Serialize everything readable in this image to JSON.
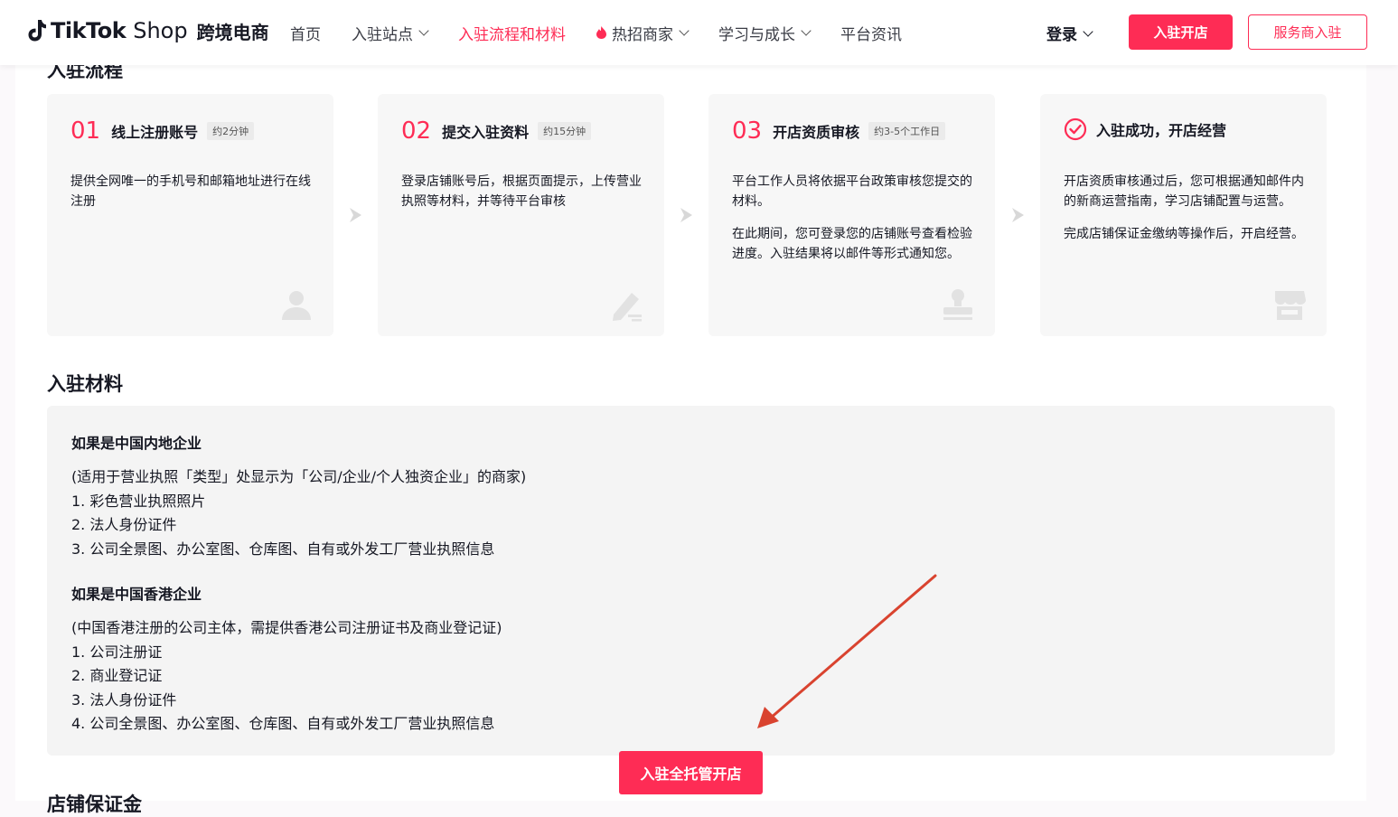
{
  "header": {
    "logo_brand": "TikTok",
    "logo_shop": "Shop",
    "logo_cn": "跨境电商",
    "nav": [
      {
        "label": "首页"
      },
      {
        "label": "入驻站点"
      },
      {
        "label": "入驻流程和材料"
      },
      {
        "label": "热招商家"
      },
      {
        "label": "学习与成长"
      },
      {
        "label": "平台资讯"
      }
    ],
    "login_label": "登录",
    "primary_btn": "入驻开店",
    "outline_btn": "服务商入驻"
  },
  "process": {
    "title": "入驻流程",
    "steps": [
      {
        "num": "01",
        "name": "线上注册账号",
        "tag": "约2分钟",
        "desc": [
          "提供全网唯一的手机号和邮箱地址进行在线注册"
        ],
        "icon": "user-icon"
      },
      {
        "num": "02",
        "name": "提交入驻资料",
        "tag": "约15分钟",
        "desc": [
          "登录店铺账号后，根据页面提示，上传营业执照等材料，并等待平台审核"
        ],
        "icon": "edit-icon"
      },
      {
        "num": "03",
        "name": "开店资质审核",
        "tag": "约3-5个工作日",
        "desc": [
          "平台工作人员将依据平台政策审核您提交的材料。",
          "在此期间，您可登录您的店铺账号查看检验进度。入驻结果将以邮件等形式通知您。"
        ],
        "icon": "stamp-icon"
      },
      {
        "num": "",
        "name": "入驻成功，开店经营",
        "tag": "",
        "desc": [
          "开店资质审核通过后，您可根据通知邮件内的新商运营指南，学习店铺配置与运营。",
          "完成店铺保证金缴纳等操作后，开启经营。"
        ],
        "icon": "store-icon"
      }
    ]
  },
  "materials": {
    "title": "入驻材料",
    "mainland": {
      "title": "如果是中国内地企业",
      "lines": [
        "(适用于营业执照「类型」处显示为「公司/企业/个人独资企业」的商家)",
        "1. 彩色营业执照照片",
        "2. 法人身份证件",
        "3. 公司全景图、办公室图、仓库图、自有或外发工厂营业执照信息"
      ]
    },
    "hongkong": {
      "title": "如果是中国香港企业",
      "lines": [
        "(中国香港注册的公司主体，需提供香港公司注册证书及商业登记证)",
        "1. 公司注册证",
        "2. 商业登记证",
        "3. 法人身份证件",
        "4. 公司全景图、办公室图、仓库图、自有或外发工厂营业执照信息"
      ]
    }
  },
  "cta_label": "入驻全托管开店",
  "next_section_title": "店铺保证金",
  "colors": {
    "accent": "#fe2c55",
    "annotation_arrow": "#d9432f"
  }
}
